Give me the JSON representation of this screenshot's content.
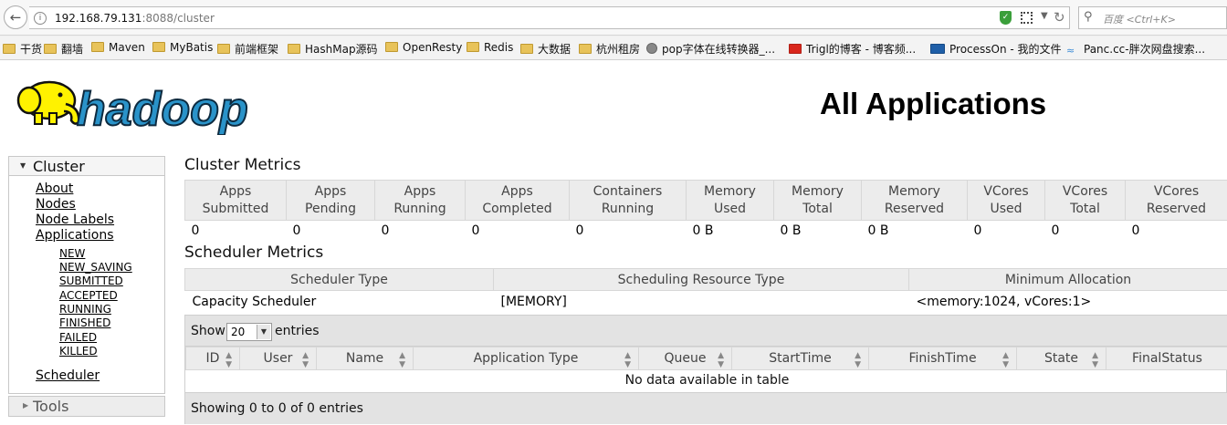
{
  "browser": {
    "url_host": "192.168.79.131",
    "url_rest": ":8088/cluster",
    "search_placeholder": "百度 <Ctrl+K>",
    "bookmarks": [
      "干货",
      "翻墙",
      "Maven",
      "MyBatis",
      "前端框架",
      "HashMap源码",
      "OpenResty",
      "Redis",
      "大数据",
      "杭州租房",
      "pop字体在线转换器_...",
      "Trigl的博客 - 博客频...",
      "ProcessOn - 我的文件",
      "Panc.cc-胖次网盘搜索..."
    ]
  },
  "header": {
    "logo_text": "hadoop",
    "title": "All Applications"
  },
  "sidebar": {
    "cluster_label": "Cluster",
    "links": [
      "About",
      "Nodes",
      "Node Labels",
      "Applications"
    ],
    "states": [
      "NEW",
      "NEW_SAVING",
      "SUBMITTED",
      "ACCEPTED",
      "RUNNING",
      "FINISHED",
      "FAILED",
      "KILLED"
    ],
    "scheduler_label": "Scheduler",
    "tools_label": "Tools"
  },
  "cluster_metrics": {
    "title": "Cluster Metrics",
    "columns": [
      [
        "Apps",
        "Submitted"
      ],
      [
        "Apps",
        "Pending"
      ],
      [
        "Apps",
        "Running"
      ],
      [
        "Apps",
        "Completed"
      ],
      [
        "Containers",
        "Running"
      ],
      [
        "Memory",
        "Used"
      ],
      [
        "Memory",
        "Total"
      ],
      [
        "Memory",
        "Reserved"
      ],
      [
        "VCores",
        "Used"
      ],
      [
        "VCores",
        "Total"
      ],
      [
        "VCores",
        "Reserved"
      ]
    ],
    "values": [
      "0",
      "0",
      "0",
      "0",
      "0",
      "0 B",
      "0 B",
      "0 B",
      "0",
      "0",
      "0"
    ]
  },
  "scheduler_metrics": {
    "title": "Scheduler Metrics",
    "columns": [
      "Scheduler Type",
      "Scheduling Resource Type",
      "Minimum Allocation"
    ],
    "values": [
      "Capacity Scheduler",
      "[MEMORY]",
      "<memory:1024, vCores:1>"
    ]
  },
  "apps_table": {
    "show_label": "Show",
    "page_length": "20",
    "entries_label": "entries",
    "columns": [
      "ID",
      "User",
      "Name",
      "Application Type",
      "Queue",
      "StartTime",
      "FinishTime",
      "State",
      "FinalStatus"
    ],
    "empty_message": "No data available in table",
    "info": "Showing 0 to 0 of 0 entries"
  }
}
